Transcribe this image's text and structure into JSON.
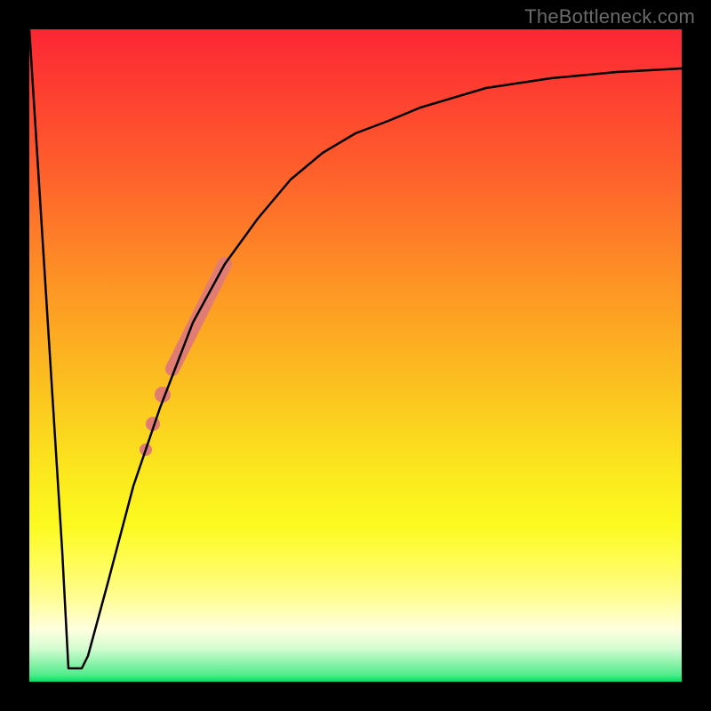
{
  "watermark": "TheBottleneck.com",
  "chart_data": {
    "type": "line",
    "title": "",
    "xlabel": "",
    "ylabel": "",
    "xlim": [
      0,
      100
    ],
    "ylim": [
      0,
      100
    ],
    "grid": false,
    "legend": false,
    "background_gradient": {
      "direction": "top-to-bottom",
      "stops": [
        {
          "pos": 0.0,
          "color": "#fd2634"
        },
        {
          "pos": 0.22,
          "color": "#fe602c"
        },
        {
          "pos": 0.4,
          "color": "#fd9724"
        },
        {
          "pos": 0.55,
          "color": "#fbc21f"
        },
        {
          "pos": 0.68,
          "color": "#fbe81e"
        },
        {
          "pos": 0.82,
          "color": "#fffc58"
        },
        {
          "pos": 0.92,
          "color": "#ffffde"
        },
        {
          "pos": 1.0,
          "color": "#05df5f"
        }
      ]
    },
    "series": [
      {
        "name": "bottleneck-curve",
        "color": "#000000",
        "stroke_width": 2,
        "x": [
          0,
          5,
          6,
          8,
          9,
          12,
          16,
          20,
          25,
          30,
          35,
          40,
          45,
          50,
          55,
          60,
          70,
          80,
          90,
          100
        ],
        "y": [
          100,
          20,
          2,
          2,
          4,
          15,
          30,
          42,
          55,
          64,
          71,
          77,
          81,
          84,
          86,
          88,
          91,
          92.5,
          93.5,
          94
        ]
      }
    ],
    "markers": [
      {
        "name": "highlight-segment",
        "shape": "round-capsule",
        "color": "#e07c74",
        "path": {
          "x": [
            22,
            30
          ],
          "y": [
            48,
            64
          ]
        },
        "width": 16
      },
      {
        "name": "dot-1",
        "shape": "circle",
        "color": "#e07c74",
        "cx": 20.5,
        "cy": 44.0,
        "r": 9
      },
      {
        "name": "dot-2",
        "shape": "circle",
        "color": "#e07c74",
        "cx": 19.0,
        "cy": 39.5,
        "r": 8
      },
      {
        "name": "dot-3",
        "shape": "circle",
        "color": "#e07c74",
        "cx": 17.8,
        "cy": 35.5,
        "r": 7
      }
    ]
  }
}
